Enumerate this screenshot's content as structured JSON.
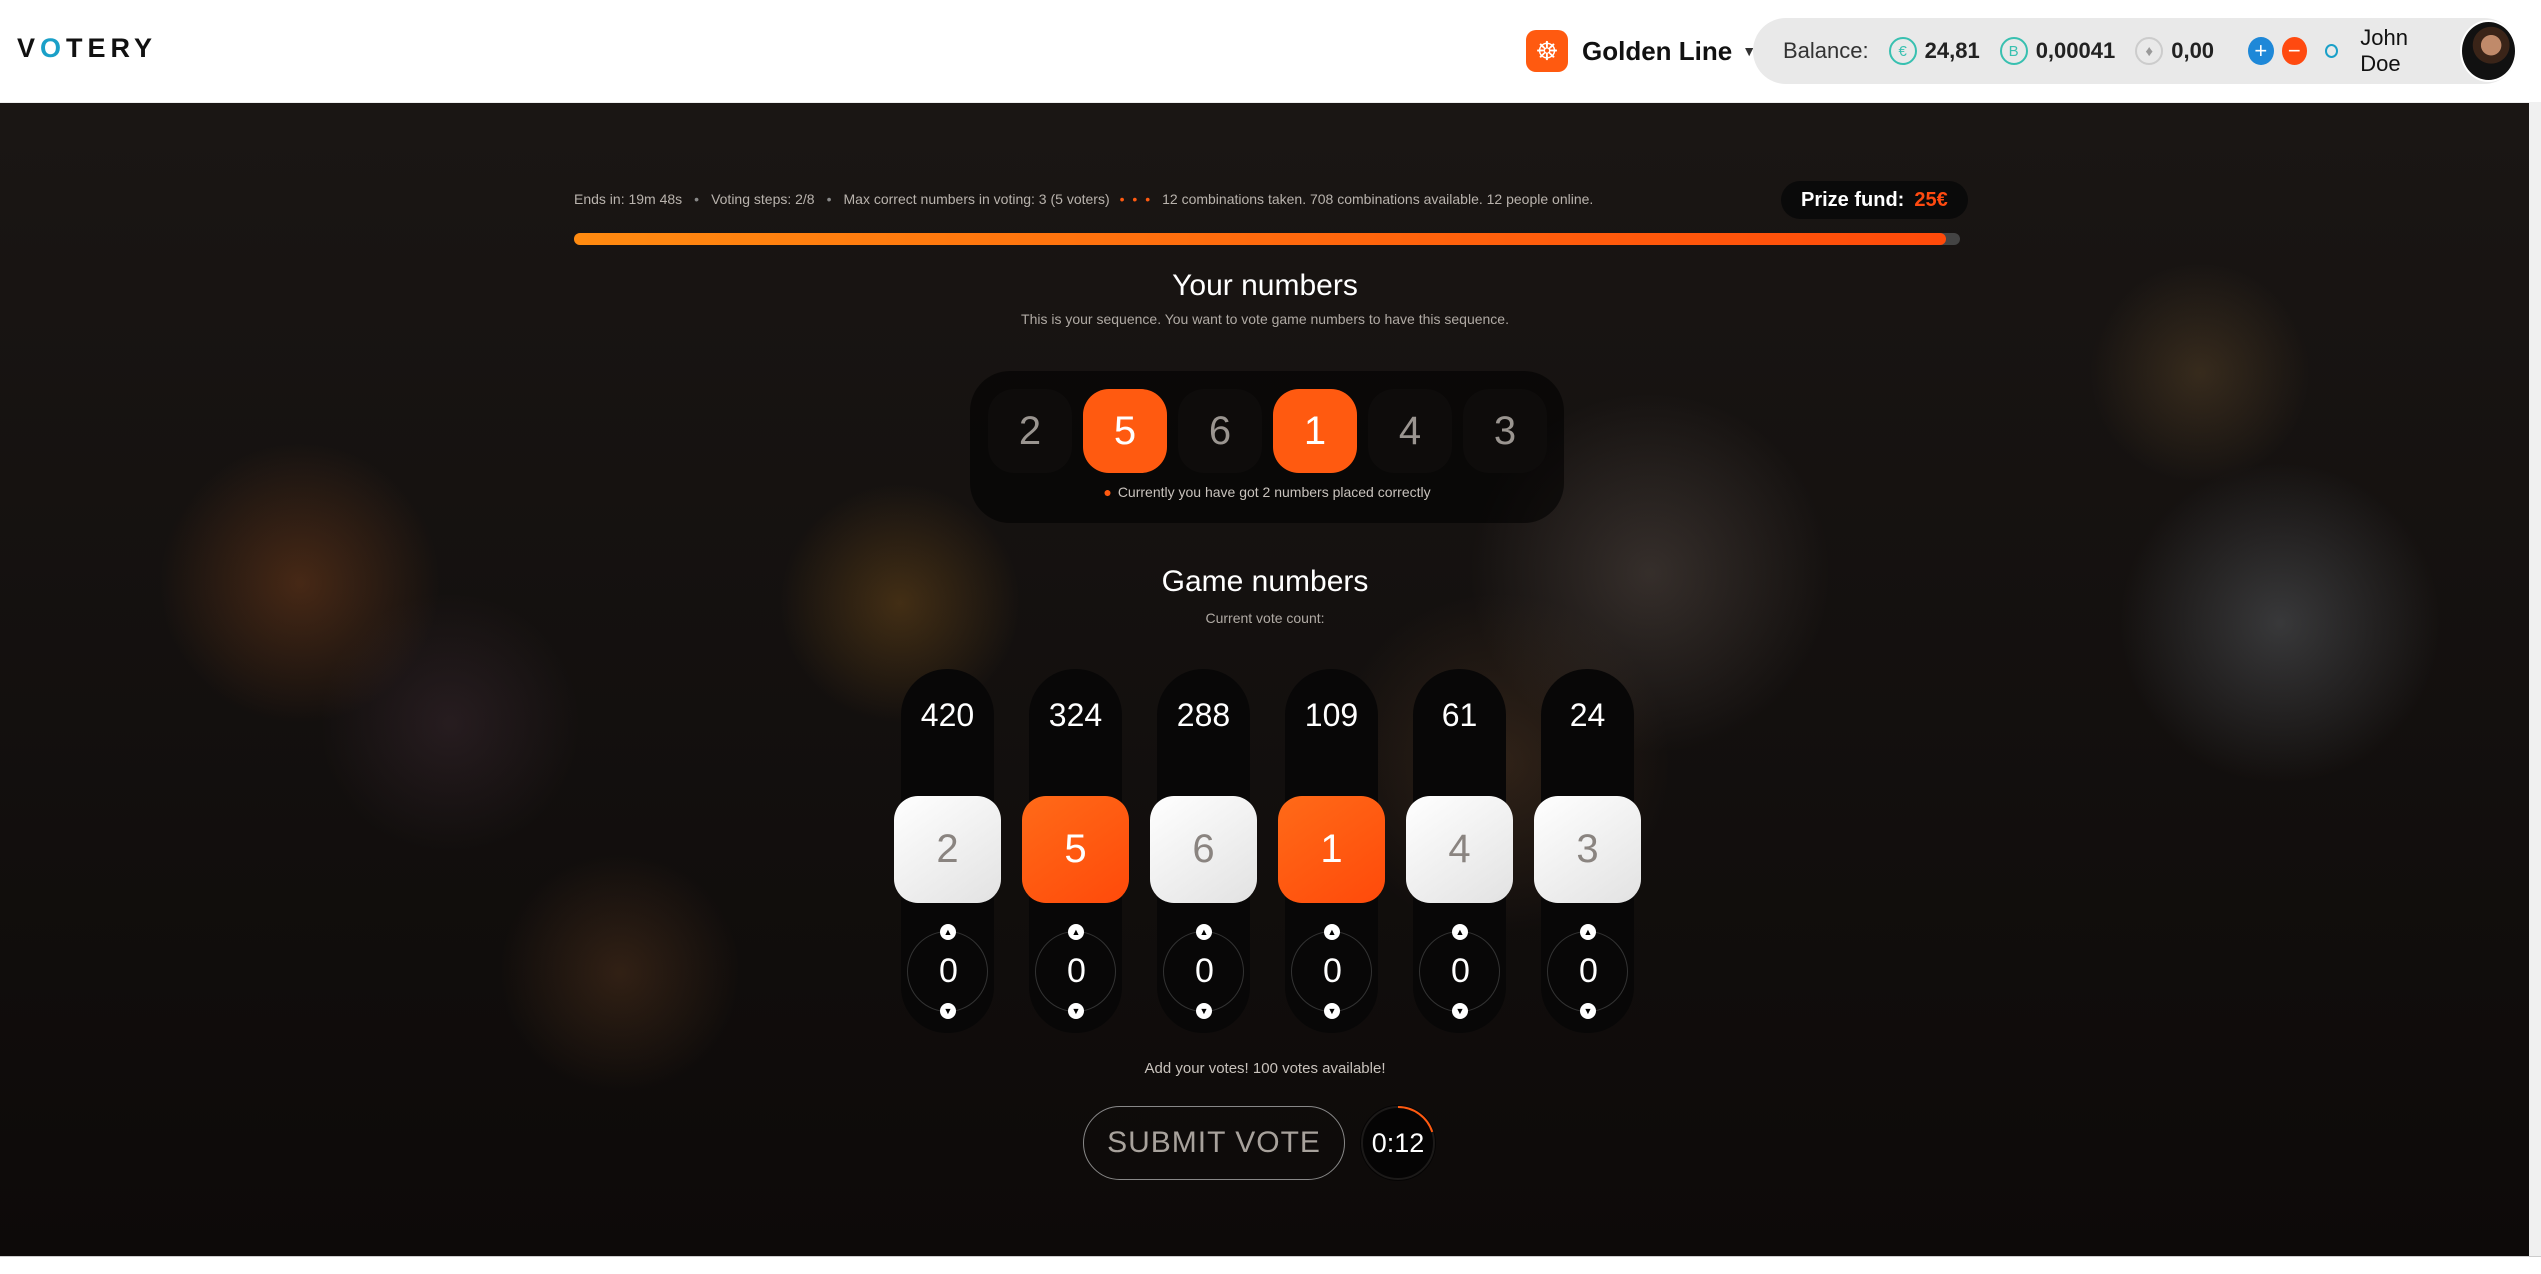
{
  "header": {
    "logo": "VOTERY",
    "line_name": "Golden Line",
    "balance_label": "Balance:",
    "currencies": [
      {
        "icon": "euro-icon",
        "symbol": "€",
        "value": "24,81"
      },
      {
        "icon": "bitcoin-icon",
        "symbol": "B",
        "value": "0,00041"
      },
      {
        "icon": "ethereum-icon",
        "symbol": "♦",
        "value": "0,00"
      }
    ],
    "plus": "+",
    "minus": "−",
    "user_name": "John Doe"
  },
  "stats": {
    "ends_in": "Ends in: 19m 48s",
    "voting_steps": "Voting steps: 2/8",
    "max_correct": "Max correct numbers in voting: 3 (5 voters)",
    "dots": "• • •",
    "summary": "12 combinations taken. 708 combinations available. 12 people online."
  },
  "prize": {
    "label": "Prize fund:",
    "value": "25€"
  },
  "progress": 0.99,
  "your_numbers": {
    "title": "Your numbers",
    "subtitle": "This is your sequence. You want to vote game numbers to have this sequence.",
    "balls": [
      {
        "value": "2",
        "hit": false
      },
      {
        "value": "5",
        "hit": true
      },
      {
        "value": "6",
        "hit": false
      },
      {
        "value": "1",
        "hit": true
      },
      {
        "value": "4",
        "hit": false
      },
      {
        "value": "3",
        "hit": false
      }
    ],
    "note": "Currently you have got 2 numbers placed correctly"
  },
  "game_numbers": {
    "title": "Game numbers",
    "subtitle": "Current vote count:",
    "columns": [
      {
        "count": "420",
        "number": "2",
        "hit": false,
        "votes": "0"
      },
      {
        "count": "324",
        "number": "5",
        "hit": true,
        "votes": "0"
      },
      {
        "count": "288",
        "number": "6",
        "hit": false,
        "votes": "0"
      },
      {
        "count": "109",
        "number": "1",
        "hit": true,
        "votes": "0"
      },
      {
        "count": "61",
        "number": "4",
        "hit": false,
        "votes": "0"
      },
      {
        "count": "24",
        "number": "3",
        "hit": false,
        "votes": "0"
      }
    ],
    "add_note": "Add your votes! 100 votes available!"
  },
  "submit_label": "SUBMIT VOTE",
  "timer": "0:12",
  "timer_fraction": 0.2,
  "colors": {
    "accent": "#ff5a10",
    "teal": "#38c0b0",
    "blue": "#1e88d8"
  }
}
